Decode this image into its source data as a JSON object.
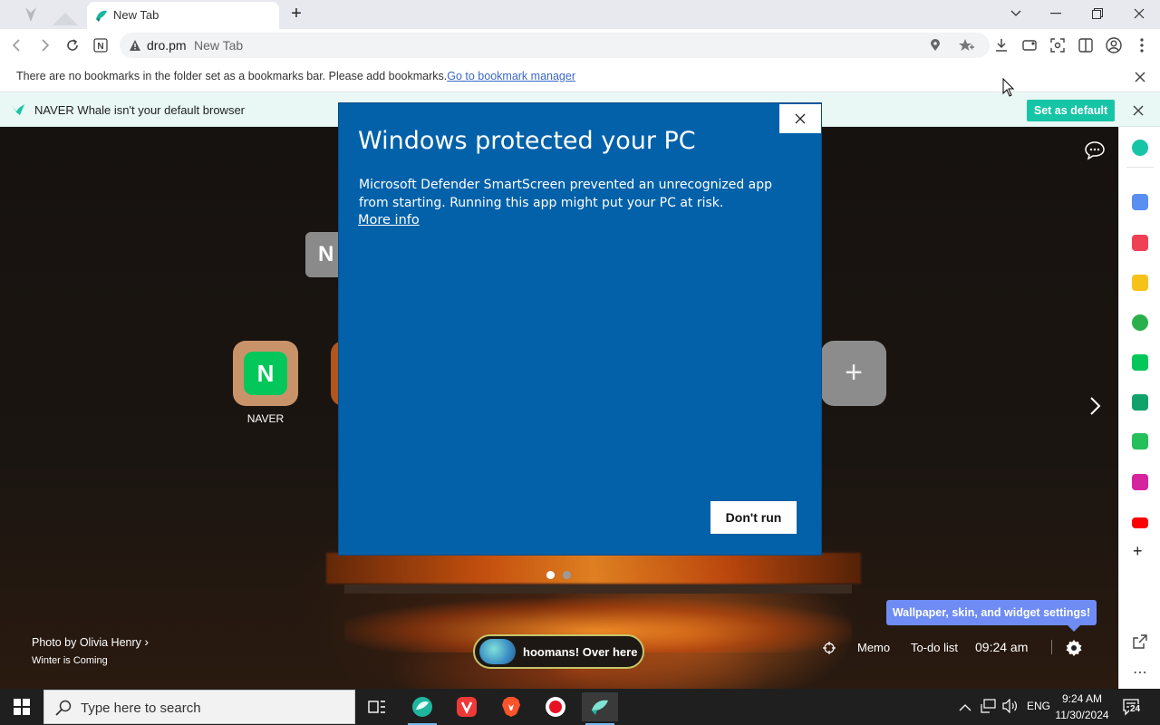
{
  "browser": {
    "tab_title": "New Tab",
    "address": {
      "host": "dro.pm",
      "page_title": "New Tab"
    },
    "bookmarks_bar": {
      "message": "There are no bookmarks in the folder set as a bookmarks bar. Please add bookmarks.",
      "link": "Go to bookmark manager"
    },
    "infobar": {
      "message": "NAVER Whale isn't your default browser",
      "set_default_label": "Set as default"
    }
  },
  "new_tab_page": {
    "naver_logo_letter": "N",
    "shortcuts": [
      {
        "label": "NAVER",
        "letter": "N"
      }
    ],
    "add_shortcut_symbol": "+",
    "photo_credit": "Photo by Olivia Henry",
    "photo_subtitle": "Winter is Coming",
    "pill_text": "hoomans! Over here",
    "tooltip": "Wallpaper, skin, and widget settings!",
    "widgets": {
      "memo": "Memo",
      "todo": "To-do list",
      "time": "09:24 am"
    }
  },
  "dialog": {
    "title": "Windows protected your PC",
    "body": "Microsoft Defender SmartScreen prevented an unrecognized app from starting. Running this app might put your PC at risk.",
    "more_info": "More info",
    "dont_run": "Don't run"
  },
  "taskbar": {
    "search_placeholder": "Type here to search",
    "language": "ENG",
    "time": "9:24 AM",
    "date": "11/30/2024",
    "notification_count": "24"
  },
  "colors": {
    "dialog_blue": "#0261a9",
    "whale_accent": "#16c5a6",
    "naver_green": "#03c75a",
    "tooltip_blue": "#6e8cf4"
  }
}
